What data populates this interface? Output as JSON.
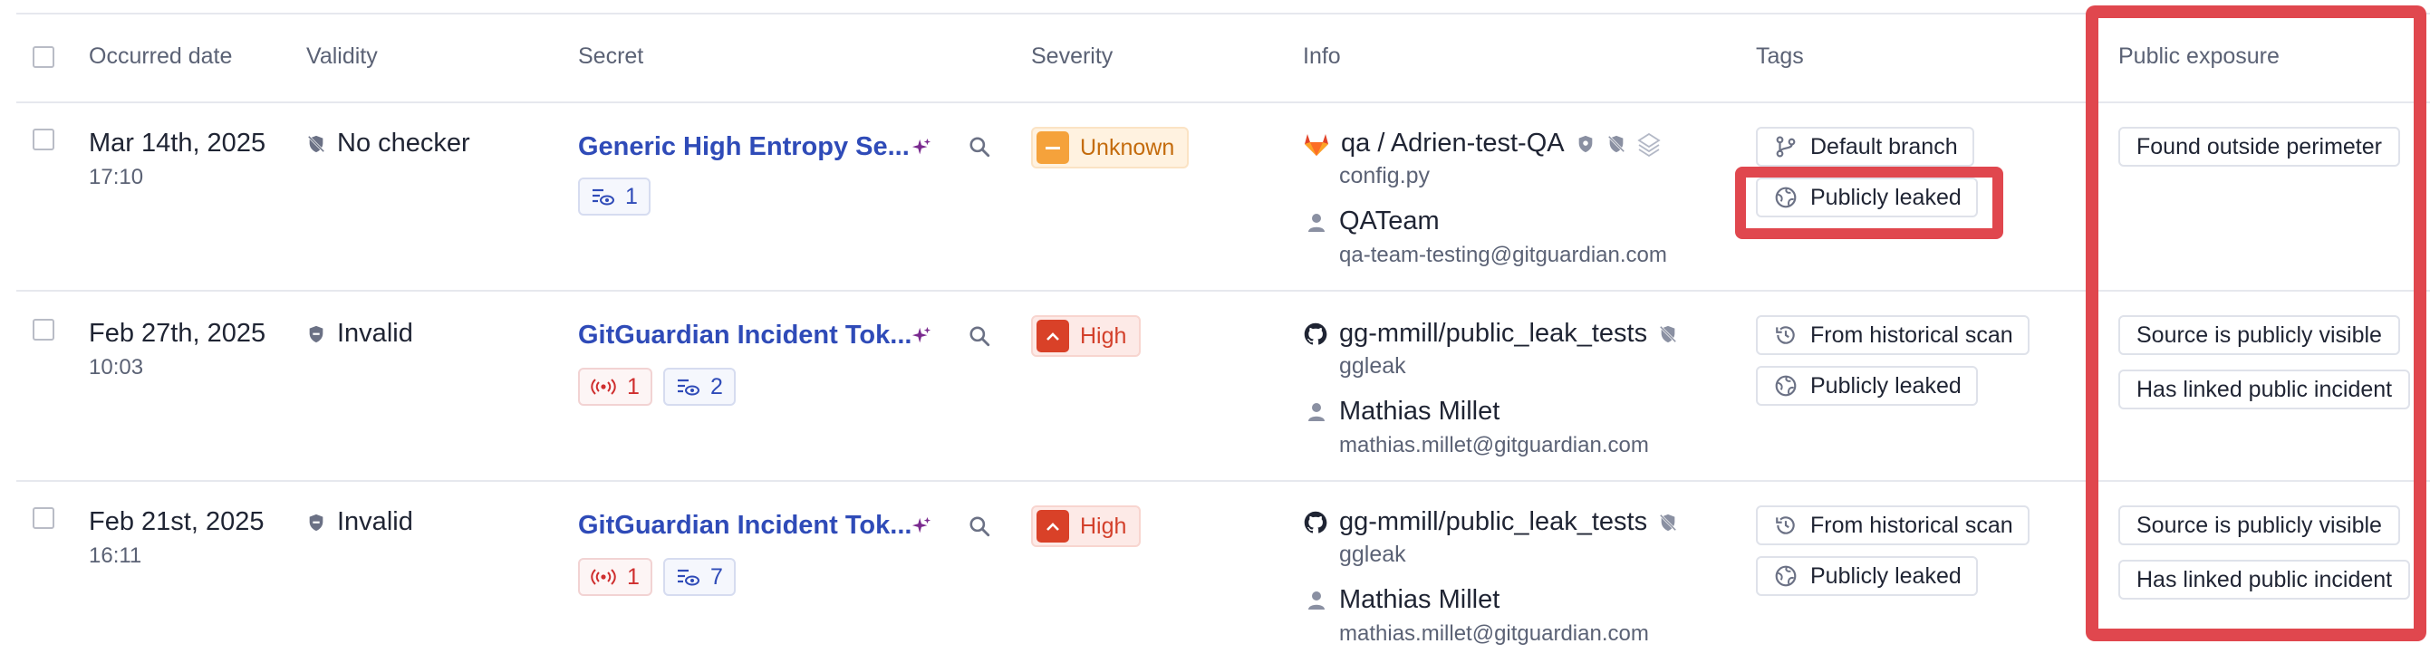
{
  "headers": {
    "occurred_date": "Occurred date",
    "validity": "Validity",
    "secret": "Secret",
    "severity": "Severity",
    "info": "Info",
    "tags": "Tags",
    "public_exposure": "Public exposure"
  },
  "rows": [
    {
      "date": "Mar 14th, 2025",
      "time": "17:10",
      "validity": "No checker",
      "secret_name": "Generic High Entropy Se...",
      "chips": [
        {
          "type": "views",
          "value": "1"
        }
      ],
      "severity": "Unknown",
      "repo": "qa / Adrien-test-QA",
      "repo_icon": "gitlab-icon",
      "file": "config.py",
      "person": "QATeam",
      "email": "qa-team-testing@gitguardian.com",
      "tags": [
        {
          "icon": "branch-icon",
          "label": "Default branch"
        },
        {
          "icon": "globe-icon",
          "label": "Publicly leaked"
        }
      ],
      "public_exposure": [
        "Found outside perimeter"
      ]
    },
    {
      "date": "Feb 27th, 2025",
      "time": "10:03",
      "validity": "Invalid",
      "secret_name": "GitGuardian Incident Tok...",
      "chips": [
        {
          "type": "occurrences",
          "value": "1"
        },
        {
          "type": "views",
          "value": "2"
        }
      ],
      "severity": "High",
      "repo": "gg-mmill/public_leak_tests",
      "repo_icon": "github-icon",
      "file": "ggleak",
      "person": "Mathias Millet",
      "email": "mathias.millet@gitguardian.com",
      "tags": [
        {
          "icon": "history-icon",
          "label": "From historical scan"
        },
        {
          "icon": "globe-icon",
          "label": "Publicly leaked"
        }
      ],
      "public_exposure": [
        "Source is publicly visible",
        "Has linked public incident"
      ]
    },
    {
      "date": "Feb 21st, 2025",
      "time": "16:11",
      "validity": "Invalid",
      "secret_name": "GitGuardian Incident Tok...",
      "chips": [
        {
          "type": "occurrences",
          "value": "1"
        },
        {
          "type": "views",
          "value": "7"
        }
      ],
      "severity": "High",
      "repo": "gg-mmill/public_leak_tests",
      "repo_icon": "github-icon",
      "file": "ggleak",
      "person": "Mathias Millet",
      "email": "mathias.millet@gitguardian.com",
      "tags": [
        {
          "icon": "history-icon",
          "label": "From historical scan"
        },
        {
          "icon": "globe-icon",
          "label": "Publicly leaked"
        }
      ],
      "public_exposure": [
        "Source is publicly visible",
        "Has linked public incident"
      ]
    }
  ],
  "colors": {
    "link": "#2f4bb8",
    "annotation_red": "#e0474e",
    "severity_unknown": "#f5a23b",
    "severity_high": "#d94128"
  }
}
